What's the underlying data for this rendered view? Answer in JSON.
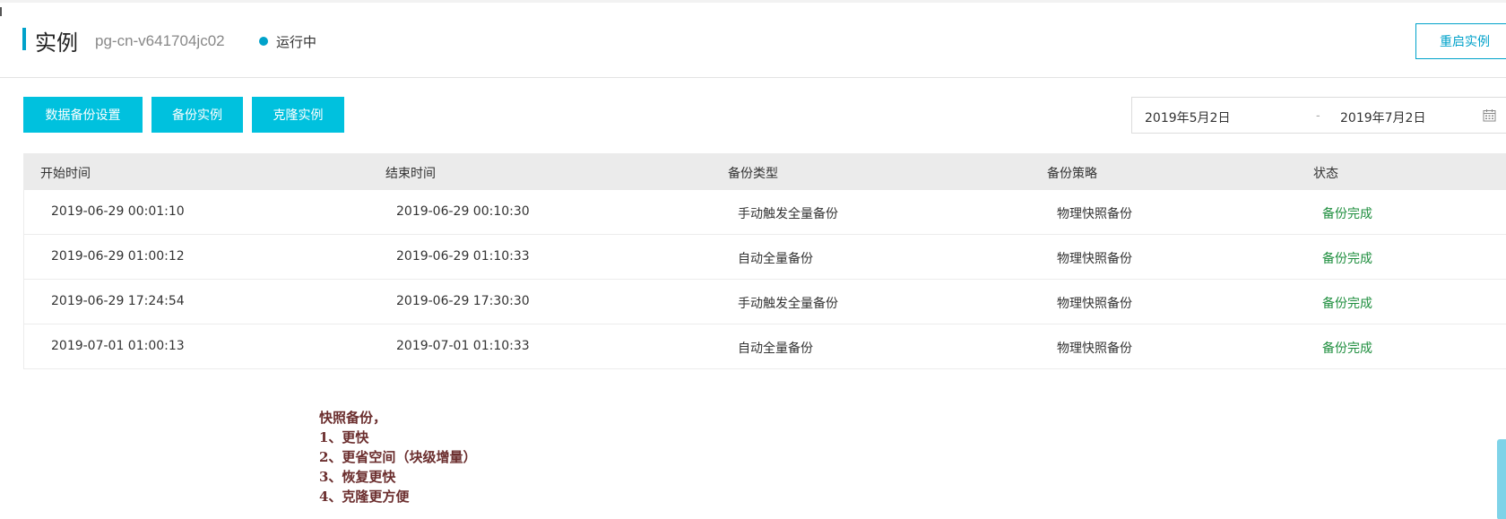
{
  "header": {
    "title": "实例",
    "instance_id": "pg-cn-v641704jc02",
    "status": "运行中",
    "restart_label": "重启实例",
    "accent_color": "#00a2ca"
  },
  "toolbar": {
    "backup_settings_label": "数据备份设置",
    "backup_instance_label": "备份实例",
    "clone_instance_label": "克隆实例",
    "button_color": "#00c1de"
  },
  "date_range": {
    "start": "2019年5月2日",
    "separator": "-",
    "end": "2019年7月2日",
    "icon": "calendar-icon"
  },
  "table": {
    "columns": [
      "开始时间",
      "结束时间",
      "备份类型",
      "备份策略",
      "状态"
    ],
    "rows": [
      [
        "2019-06-29 00:01:10",
        "2019-06-29 00:10:30",
        "手动触发全量备份",
        "物理快照备份",
        "备份完成"
      ],
      [
        "2019-06-29 01:00:12",
        "2019-06-29 01:10:33",
        "自动全量备份",
        "物理快照备份",
        "备份完成"
      ],
      [
        "2019-06-29 17:24:54",
        "2019-06-29 17:30:30",
        "手动触发全量备份",
        "物理快照备份",
        "备份完成"
      ],
      [
        "2019-07-01 01:00:13",
        "2019-07-01 01:10:33",
        "自动全量备份",
        "物理快照备份",
        "备份完成"
      ]
    ],
    "status_color": "#1e8e3e"
  },
  "notes": [
    "快照备份，",
    "1、更快",
    "2、更省空间（块级增量）",
    "3、恢复更快",
    "4、克隆更方便"
  ]
}
